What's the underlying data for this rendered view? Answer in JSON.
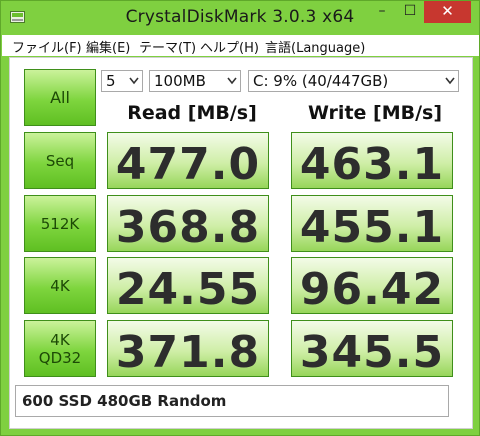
{
  "window": {
    "title": "CrystalDiskMark 3.0.3 x64",
    "min_label": "–",
    "max_label": "☐",
    "close_label": "✕"
  },
  "menu": [
    "ファイル(F)",
    "編集(E)",
    "テーマ(T)",
    "ヘルプ(H)",
    "言語(Language)"
  ],
  "controls": {
    "all_label": "All",
    "count_value": "5",
    "size_value": "100MB",
    "drive_value": "C: 9% (40/447GB)"
  },
  "headers": {
    "read": "Read [MB/s]",
    "write": "Write [MB/s]"
  },
  "rows": [
    {
      "label": "Seq",
      "read": "477.0",
      "write": "463.1"
    },
    {
      "label": "512K",
      "read": "368.8",
      "write": "455.1"
    },
    {
      "label": "4K",
      "read": "24.55",
      "write": "96.42"
    },
    {
      "label_line1": "4K",
      "label_line2": "QD32",
      "read": "371.8",
      "write": "345.5"
    }
  ],
  "comment": "600 SSD 480GB Random",
  "colors": {
    "accent_green": "#7fd040",
    "close_red": "#c7372f"
  }
}
